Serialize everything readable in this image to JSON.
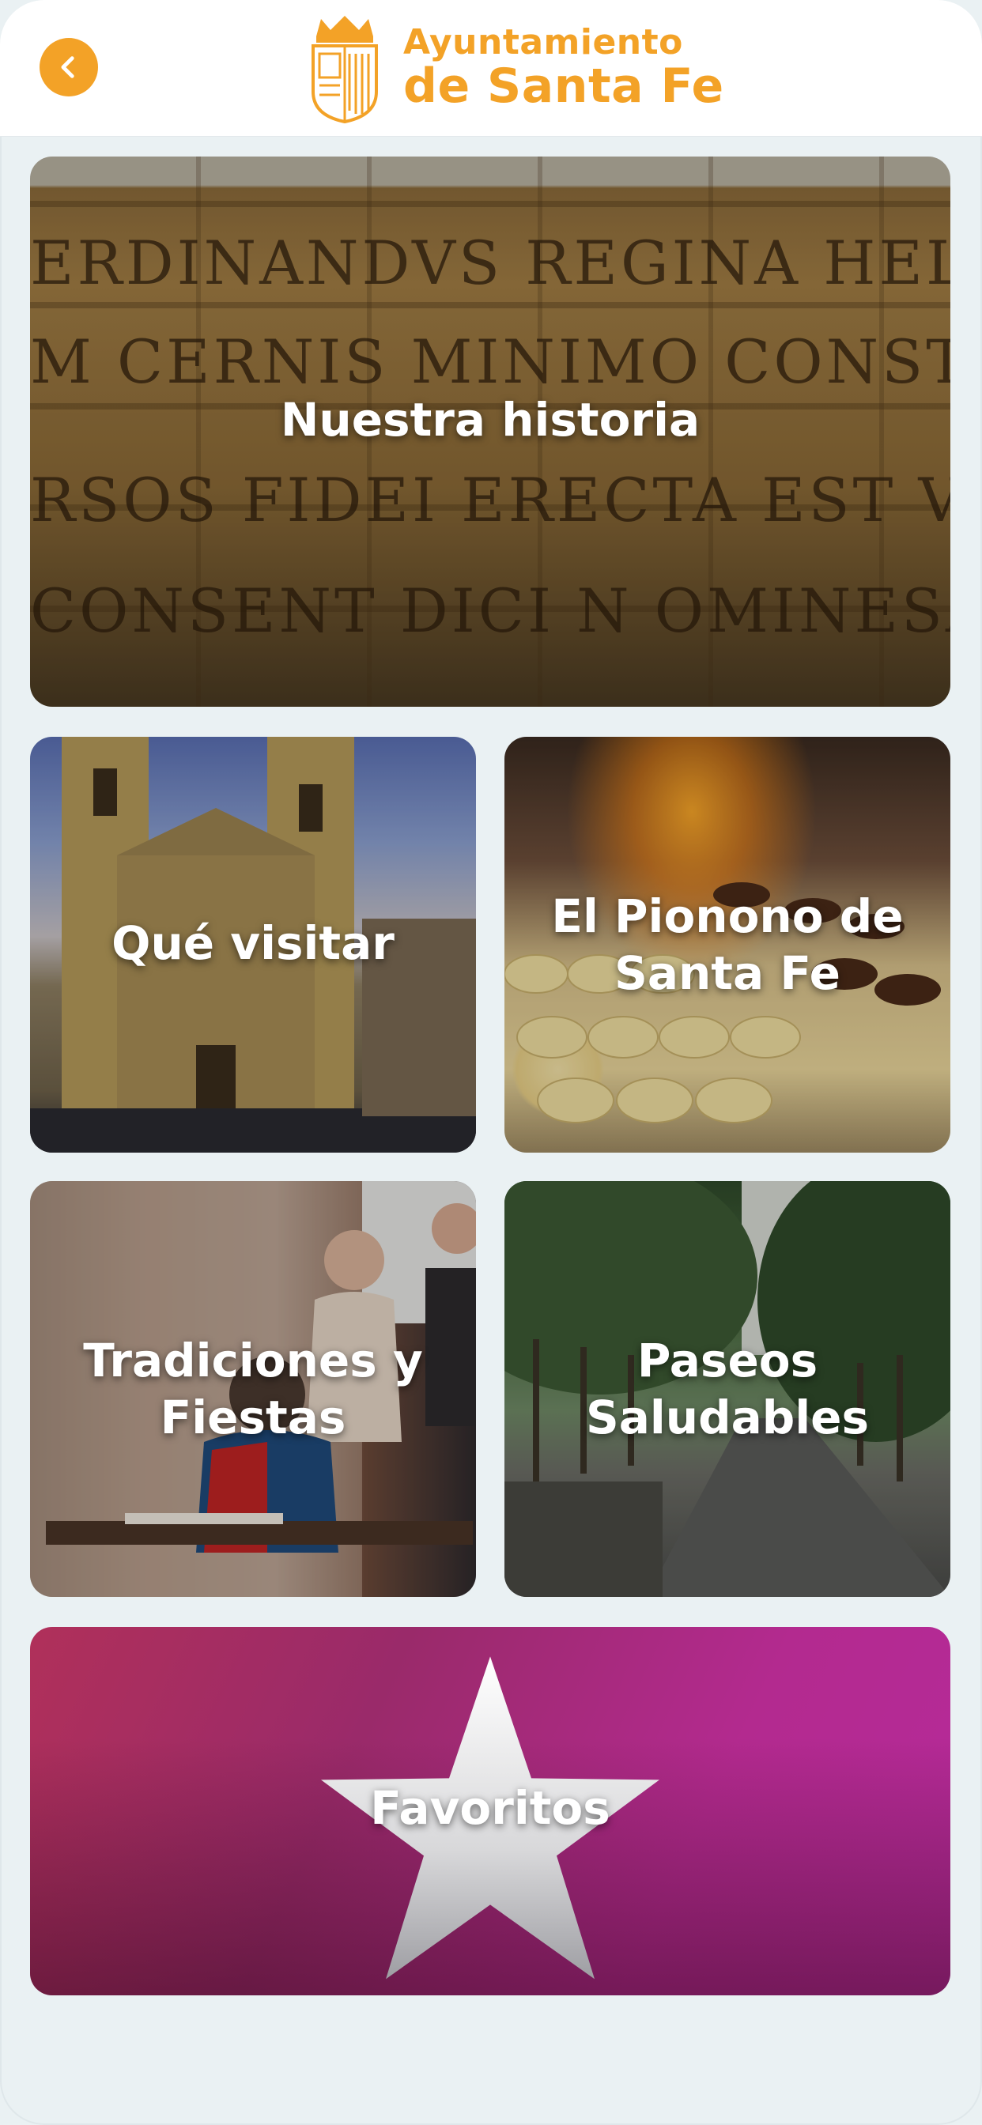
{
  "header": {
    "back_icon": "chevron-left-icon",
    "logo_icon": "coat-of-arms-icon",
    "title_line1": "Ayuntamiento",
    "title_line2": "de Santa Fe",
    "accent_color": "#f3a227"
  },
  "tiles": [
    {
      "label": "Nuestra historia",
      "image": "stone-inscription"
    },
    {
      "label": "Qué visitar",
      "image": "church-facade"
    },
    {
      "label": "El Pionono de Santa Fe",
      "image": "pionono-pastries"
    },
    {
      "label": "Tradiciones y Fiestas",
      "image": "historic-reenactment"
    },
    {
      "label": "Paseos Saludables",
      "image": "tree-lined-path"
    },
    {
      "label": "Favoritos",
      "image": "star-icon"
    }
  ],
  "inscription_lines": [
    "ERDINANDVS REGINA HELISABET",
    "M CERNIS MINIMO CONSTITVE",
    "RSOS FIDEI ERECTA EST VT COIHA",
    "CONSENT DICI N OMINESANCT"
  ]
}
